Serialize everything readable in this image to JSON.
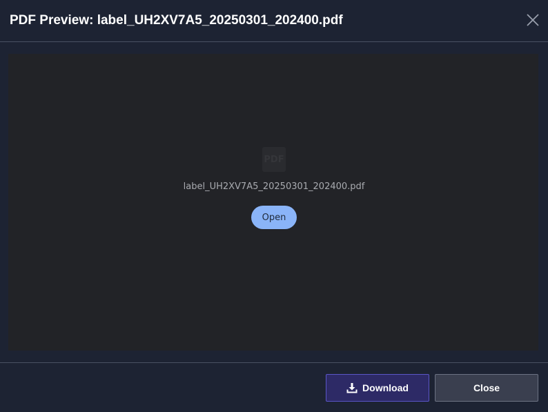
{
  "dialog": {
    "title": "PDF Preview: label_UH2XV7A5_20250301_202400.pdf",
    "close_icon": "close-icon"
  },
  "preview": {
    "icon_label": "PDF",
    "file_name": "label_UH2XV7A5_20250301_202400.pdf",
    "open_label": "Open",
    "accent_color": "#8ab4f8"
  },
  "footer": {
    "download_label": "Download",
    "download_icon": "download-icon",
    "close_label": "Close",
    "download_color": "#2d2a66"
  }
}
